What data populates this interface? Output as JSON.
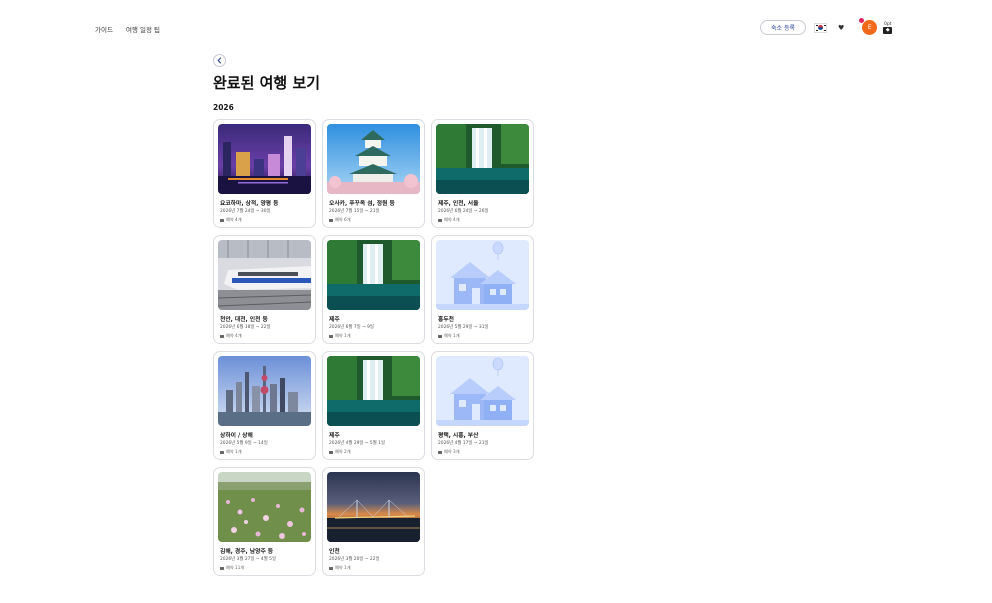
{
  "nav": {
    "items": [
      "가이드",
      "여행 일정 팁"
    ]
  },
  "header": {
    "register_label": "숙소 등록",
    "avatar_initial": "E",
    "points_label": "0pt"
  },
  "page": {
    "title": "완료된 여행 보기",
    "year": "2026"
  },
  "trips": [
    {
      "title": "요코하마, 상적, 양평 등",
      "dates": "2026년 7월 24일 ~ 30일",
      "count": "예약 4개",
      "image": "city-night"
    },
    {
      "title": "오사카, 푸꾸옥 섬, 정원 등",
      "dates": "2026년 7월 15일 ~ 21일",
      "count": "예약 6개",
      "image": "castle"
    },
    {
      "title": "제주, 인천, 서울",
      "dates": "2026년 6월 24일 ~ 26일",
      "count": "예약 4개",
      "image": "waterfall"
    },
    {
      "title": "천안, 대전, 인천 등",
      "dates": "2026년 6월 18일 ~ 22일",
      "count": "예약 4개",
      "image": "train"
    },
    {
      "title": "제주",
      "dates": "2026년 6월 7일 ~ 9일",
      "count": "예약 1개",
      "image": "waterfall"
    },
    {
      "title": "홍두천",
      "dates": "2026년 5월 29일 ~ 31일",
      "count": "예약 1개",
      "image": "house"
    },
    {
      "title": "상하이 / 상해",
      "dates": "2026년 5월 9일 ~ 14일",
      "count": "예약 1개",
      "image": "skyline"
    },
    {
      "title": "제주",
      "dates": "2026년 4월 29일 ~ 5월 1일",
      "count": "예약 2개",
      "image": "waterfall"
    },
    {
      "title": "평택, 시흥, 부산",
      "dates": "2026년 4월 17일 ~ 21일",
      "count": "예약 3개",
      "image": "house"
    },
    {
      "title": "김해, 경주, 남양주 등",
      "dates": "2026년 3월 27일 ~ 4월 5일",
      "count": "예약 11개",
      "image": "field"
    },
    {
      "title": "인천",
      "dates": "2026년 3월 20일 ~ 22일",
      "count": "예약 1개",
      "image": "bridge"
    }
  ]
}
